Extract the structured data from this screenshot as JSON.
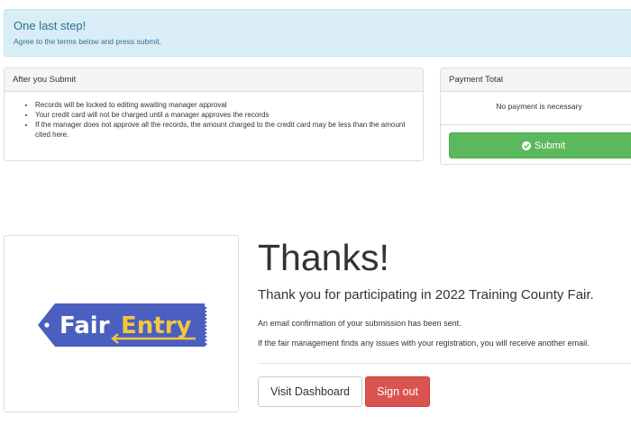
{
  "alert": {
    "title": "One last step!",
    "text": "Agree to the terms below and press submit."
  },
  "after_submit": {
    "heading": "After you Submit",
    "items": [
      "Records will be locked to editing awaiting manager approval",
      "Your credit card will not be charged until a manager approves the records",
      "If the manager does not approve all the records, the amount charged to the credit card may be less than the amount cited here."
    ]
  },
  "payment": {
    "heading": "Payment Total",
    "text": "No payment is necessary",
    "submit_label": "Submit",
    "submit_icon": "check-circle-icon"
  },
  "logo": {
    "word1": "Fair",
    "word2": "Entry",
    "colors": {
      "tag": "#4a5fbf",
      "text": "#ffffff",
      "accent": "#f5c542"
    }
  },
  "thanks": {
    "title": "Thanks!",
    "subtitle": "Thank you for participating in 2022 Training County Fair.",
    "line1": "An email confirmation of your submission has been sent.",
    "line2": "If the fair management finds any issues with your registration, you will receive another email."
  },
  "buttons": {
    "dashboard": "Visit Dashboard",
    "signout": "Sign out"
  },
  "colors": {
    "alert_bg": "#d9edf7",
    "alert_text": "#31708f",
    "success": "#5cb85c",
    "danger": "#d9534f"
  }
}
